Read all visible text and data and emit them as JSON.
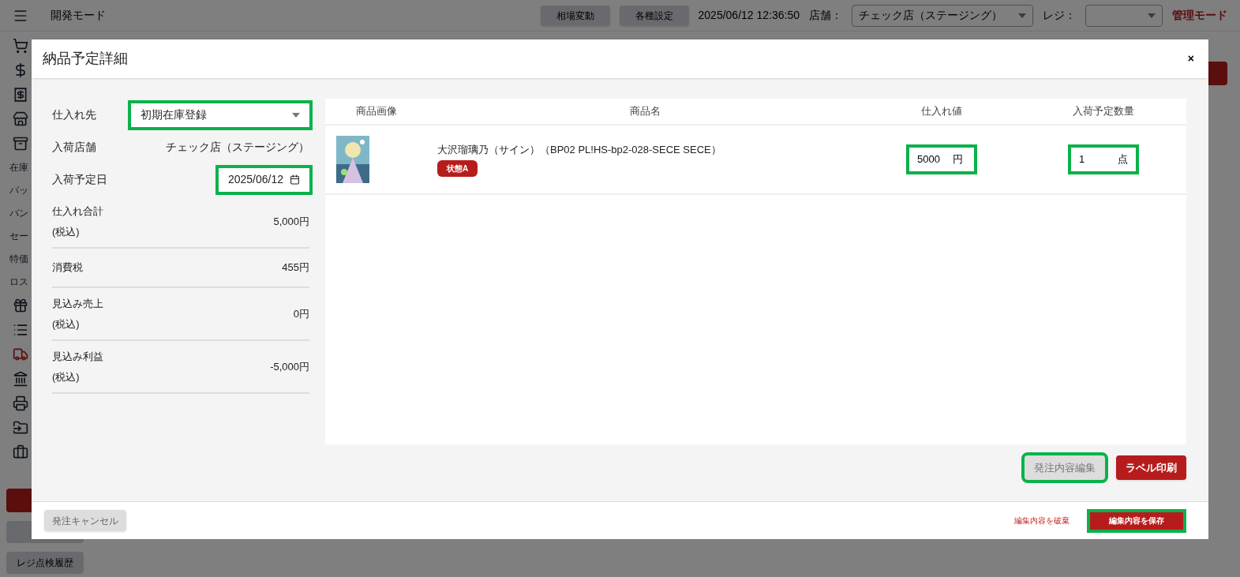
{
  "header": {
    "title": "開発モード",
    "buttons": [
      "相場変動",
      "各種設定"
    ],
    "datetime": "2025/06/12 12:36:50",
    "store_label": "店舗：",
    "store_value": "チェック店（ステージング）",
    "register_label": "レジ：",
    "mode": "管理モード"
  },
  "sidebar": {
    "labels": [
      "在庫",
      "パッ",
      "バン",
      "セー",
      "特価",
      "ロス"
    ],
    "buttons": [
      "レジ点検履歴"
    ]
  },
  "modal": {
    "title": "納品予定詳細",
    "close": "×",
    "fields": [
      {
        "kind": "select",
        "label": "仕入れ先",
        "value": "初期在庫登録",
        "highlighted": true
      },
      {
        "kind": "text",
        "label": "入荷店舗",
        "value": "チェック店（ステージング）"
      },
      {
        "kind": "date",
        "label": "入荷予定日",
        "value": "2025/06/12",
        "highlighted": true
      }
    ],
    "summary": [
      {
        "label": "仕入れ合計",
        "sub": "(税込)",
        "value": "5,000円"
      },
      {
        "label": "消費税",
        "value": "455円"
      },
      {
        "label": "見込み売上",
        "sub": "(税込)",
        "value": "0円"
      },
      {
        "label": "見込み利益",
        "sub": "(税込)",
        "value": "-5,000円"
      }
    ],
    "table": {
      "columns": [
        "商品画像",
        "商品名",
        "仕入れ値",
        "入荷予定数量"
      ],
      "rows": [
        {
          "name": "大沢瑠璃乃（サイン）（BP02 PL!HS-bp2-028-SECE SECE）",
          "tag": "状態A",
          "price": {
            "value": "5000",
            "unit": "円",
            "highlighted": true
          },
          "quantity": {
            "value": "1",
            "unit": "点",
            "highlighted": true
          }
        }
      ]
    },
    "actions": [
      {
        "label": "発注内容編集",
        "kind": "secondary",
        "highlighted": true
      },
      {
        "label": "ラベル印刷",
        "kind": "primary",
        "highlighted": false
      }
    ],
    "footer": {
      "cancel": "発注キャンセル",
      "discard": "編集内容を破棄",
      "save": {
        "label": "編集内容を保存",
        "highlighted": true
      }
    }
  }
}
